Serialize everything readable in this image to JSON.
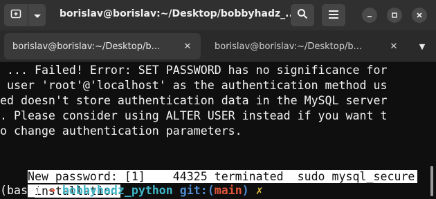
{
  "window": {
    "title": "borislav@borislav:~/Desktop/bobbyhadz_...",
    "icons": {
      "new_tab": "new-tab-icon",
      "menu_dropdown": "chevron-down-icon",
      "search": "search-icon",
      "hamburger": "hamburger-menu-icon",
      "minimize": "minimize-icon",
      "maximize": "maximize-icon",
      "close": "close-icon"
    }
  },
  "tabs": [
    {
      "label": "borislav@borislav:~/Desktop/b...",
      "active": true
    },
    {
      "label": "borislav@borislav:~/Desktop/b...",
      "active": false
    }
  ],
  "terminal": {
    "lines": [
      " ... Failed! Error: SET PASSWORD has no significance for",
      " user 'root'@'localhost' as the authentication method us",
      "ed doesn't store authentication data in the MySQL server",
      ". Please consider using ALTER USER instead if you want t",
      "o change authentication parameters."
    ],
    "highlighted_lines": [
      "New password: [1]    44325 terminated  sudo mysql_secure",
      "_installation"
    ],
    "prompt": {
      "env": "(base) ",
      "arrow": "➜",
      "dir": "bobbyhadz_python",
      "git_label": "git:",
      "paren_open": "(",
      "branch": "main",
      "paren_close": ")",
      "dirty": "✗"
    }
  },
  "colors": {
    "background": "#0f0f0f",
    "titlebar": "#303030",
    "prompt_arrow": "#e0553a",
    "prompt_dir": "#3fb6c8",
    "prompt_git": "#4d8ad0",
    "prompt_dirty": "#e6c23a"
  }
}
